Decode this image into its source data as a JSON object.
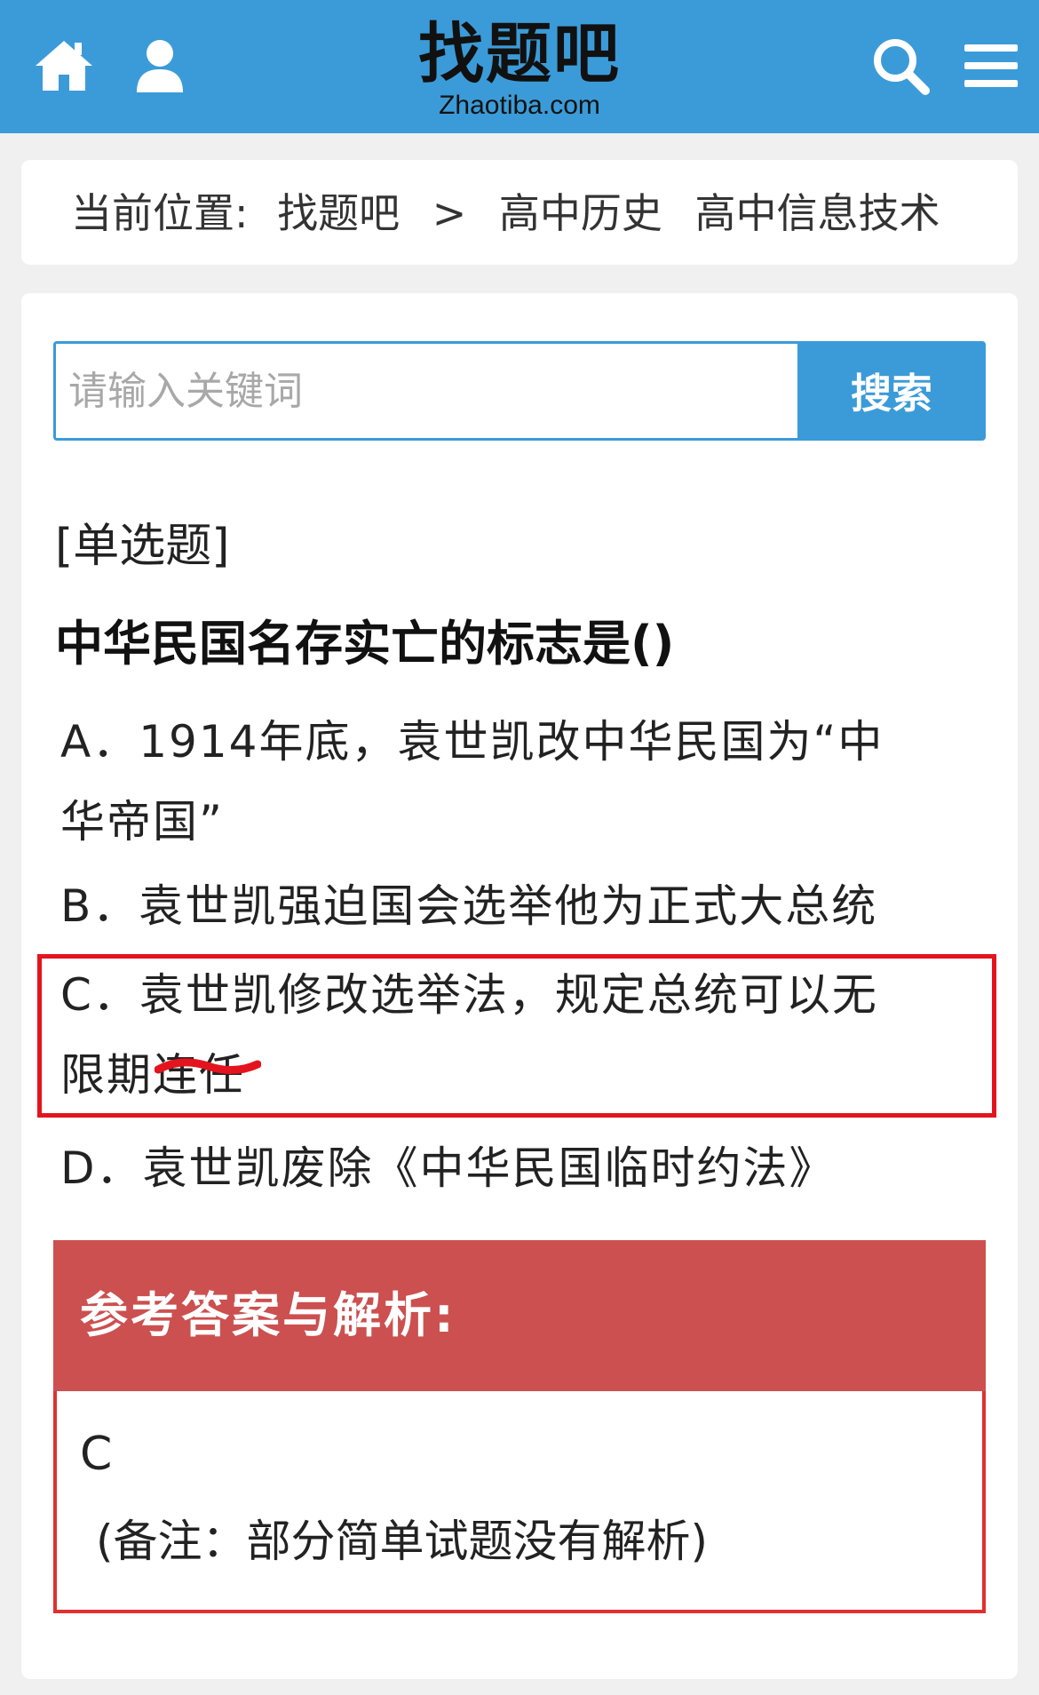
{
  "header": {
    "logo_main": "找题吧",
    "logo_sub": "Zhaotiba.com",
    "icons": [
      "home-icon",
      "user-icon",
      "search-icon",
      "menu-icon"
    ],
    "color": "#3b9bd8"
  },
  "breadcrumb": {
    "prefix": "当前位置:",
    "site": "找题吧",
    "separator": ">",
    "category1": "高中历史",
    "category2": "高中信息技术"
  },
  "search": {
    "placeholder": "请输入关键词",
    "button_label": "搜索"
  },
  "question": {
    "type": "[单选题]",
    "stem": "中华民国名存实亡的标志是()",
    "options": [
      {
        "letter": "A",
        "line1": "．1914年底，袁世凯改中华民国为“中",
        "line2": "华帝国”"
      },
      {
        "letter": "B",
        "line1": "．袁世凯强迫国会选举他为正式大总统"
      },
      {
        "letter": "C",
        "line1": "．袁世凯修改选举法，规定总统可以无",
        "line2": "限期连任"
      },
      {
        "letter": "D",
        "line1": "．袁世凯废除《中华民国临时约法》"
      }
    ],
    "highlighted_option": "C",
    "highlight_color": "#e3141e"
  },
  "answer": {
    "heading": "参考答案与解析:",
    "value": "C",
    "note": "(备注：部分简单试题没有解析)",
    "heading_color": "#cc5050"
  }
}
